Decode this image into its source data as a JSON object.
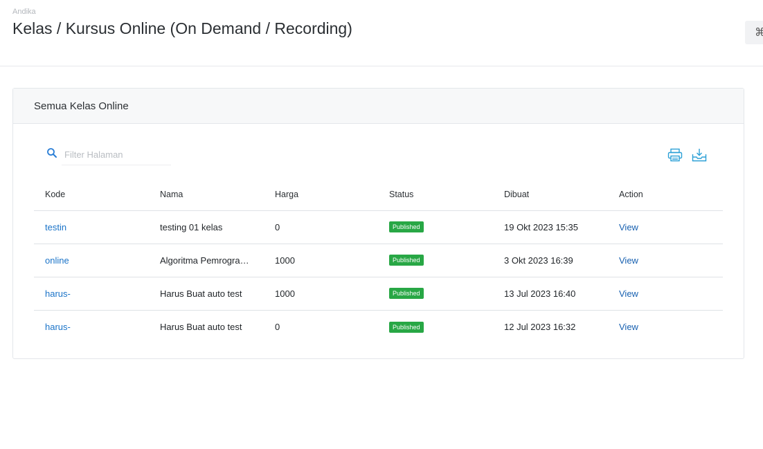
{
  "header": {
    "breadcrumb": "Andika",
    "title": "Kelas / Kursus Online (On Demand / Recording)",
    "cmd_symbol": "⌘"
  },
  "card": {
    "title": "Semua Kelas Online",
    "search": {
      "placeholder": "Filter Halaman",
      "value": ""
    },
    "tools": {
      "print": "print-icon",
      "download": "download-icon"
    },
    "columns": [
      "Kode",
      "Nama",
      "Harga",
      "Status",
      "Dibuat",
      "Action"
    ],
    "rows": [
      {
        "kode": "testin",
        "nama": "testing 01 kelas",
        "harga": "0",
        "status": "Published",
        "dibuat": "19 Okt 2023 15:35",
        "action": "View"
      },
      {
        "kode": "online",
        "nama": "Algoritma Pemrograman",
        "harga": "1000",
        "status": "Published",
        "dibuat": "3 Okt 2023 16:39",
        "action": "View"
      },
      {
        "kode": "harus-",
        "nama": "Harus Buat auto test",
        "harga": "1000",
        "status": "Published",
        "dibuat": "13 Jul 2023 16:40",
        "action": "View"
      },
      {
        "kode": "harus-",
        "nama": "Harus Buat auto test",
        "harga": "0",
        "status": "Published",
        "dibuat": "12 Jul 2023 16:32",
        "action": "View"
      }
    ]
  },
  "colors": {
    "accent": "#1a73c8",
    "badge": "#28a745",
    "icon": "#2a9fd6"
  }
}
